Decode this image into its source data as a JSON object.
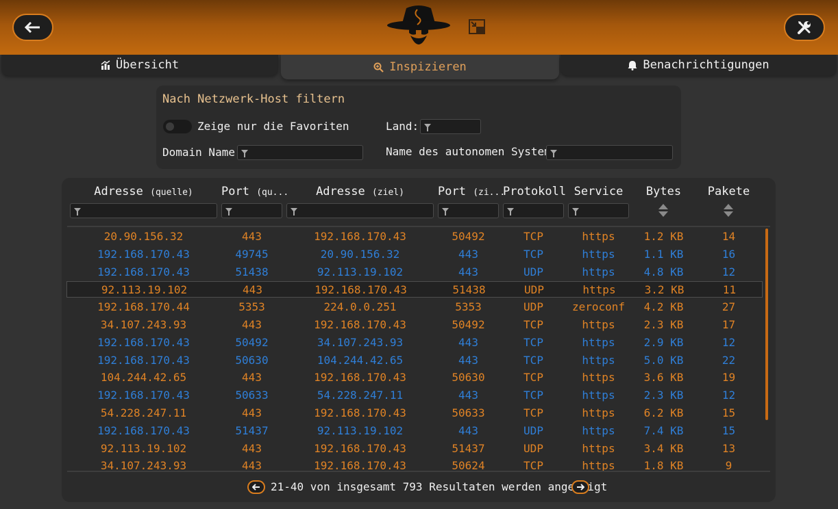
{
  "header": {
    "back_icon": "arrow-left-icon",
    "settings_icon": "wrench-screwdriver-icon",
    "logo_icon": "spy-hat-logo",
    "minimize_icon": "minimize-window-icon",
    "accent": "#d97d1e"
  },
  "tabs": [
    {
      "label": "Übersicht",
      "icon": "chart-icon"
    },
    {
      "label": "Inspizieren",
      "icon": "magnify-icon"
    },
    {
      "label": "Benachrichtigungen",
      "icon": "bell-icon"
    }
  ],
  "filter": {
    "title": "Nach Netzwerk-Host filtern",
    "favorites_label": "Zeige nur die Favoriten",
    "country_label": "Land:",
    "domain_label": "Domain Name:",
    "as_label": "Name des autonomen Systems:",
    "country_value": "",
    "domain_value": "",
    "as_value": ""
  },
  "table": {
    "headers": {
      "src_addr": "Adresse",
      "src_addr_sub": "(quelle)",
      "src_port": "Port",
      "src_port_sub": "(qu...",
      "dst_addr": "Adresse",
      "dst_addr_sub": "(ziel)",
      "dst_port": "Port",
      "dst_port_sub": "(zi...",
      "proto": "Protokoll",
      "service": "Service",
      "bytes": "Bytes",
      "packets": "Pakete"
    },
    "rows": [
      {
        "dir": "in",
        "src": "20.90.156.32",
        "sport": "443",
        "dst": "192.168.170.43",
        "dport": "50492",
        "proto": "TCP",
        "service": "https",
        "bytes": "1.2 KB",
        "packets": "14"
      },
      {
        "dir": "out",
        "src": "192.168.170.43",
        "sport": "49745",
        "dst": "20.90.156.32",
        "dport": "443",
        "proto": "TCP",
        "service": "https",
        "bytes": "1.1 KB",
        "packets": "16"
      },
      {
        "dir": "out",
        "src": "192.168.170.43",
        "sport": "51438",
        "dst": "92.113.19.102",
        "dport": "443",
        "proto": "UDP",
        "service": "https",
        "bytes": "4.8 KB",
        "packets": "12"
      },
      {
        "dir": "in",
        "src": "92.113.19.102",
        "sport": "443",
        "dst": "192.168.170.43",
        "dport": "51438",
        "proto": "UDP",
        "service": "https",
        "bytes": "3.2 KB",
        "packets": "11",
        "selected": true
      },
      {
        "dir": "in",
        "src": "192.168.170.44",
        "sport": "5353",
        "dst": "224.0.0.251",
        "dport": "5353",
        "proto": "UDP",
        "service": "zeroconf",
        "bytes": "4.2 KB",
        "packets": "27"
      },
      {
        "dir": "in",
        "src": "34.107.243.93",
        "sport": "443",
        "dst": "192.168.170.43",
        "dport": "50492",
        "proto": "TCP",
        "service": "https",
        "bytes": "2.3 KB",
        "packets": "17"
      },
      {
        "dir": "out",
        "src": "192.168.170.43",
        "sport": "50492",
        "dst": "34.107.243.93",
        "dport": "443",
        "proto": "TCP",
        "service": "https",
        "bytes": "2.9 KB",
        "packets": "12"
      },
      {
        "dir": "out",
        "src": "192.168.170.43",
        "sport": "50630",
        "dst": "104.244.42.65",
        "dport": "443",
        "proto": "TCP",
        "service": "https",
        "bytes": "5.0 KB",
        "packets": "22"
      },
      {
        "dir": "in",
        "src": "104.244.42.65",
        "sport": "443",
        "dst": "192.168.170.43",
        "dport": "50630",
        "proto": "TCP",
        "service": "https",
        "bytes": "3.6 KB",
        "packets": "19"
      },
      {
        "dir": "out",
        "src": "192.168.170.43",
        "sport": "50633",
        "dst": "54.228.247.11",
        "dport": "443",
        "proto": "TCP",
        "service": "https",
        "bytes": "2.3 KB",
        "packets": "12"
      },
      {
        "dir": "in",
        "src": "54.228.247.11",
        "sport": "443",
        "dst": "192.168.170.43",
        "dport": "50633",
        "proto": "TCP",
        "service": "https",
        "bytes": "6.2 KB",
        "packets": "15"
      },
      {
        "dir": "out",
        "src": "192.168.170.43",
        "sport": "51437",
        "dst": "92.113.19.102",
        "dport": "443",
        "proto": "UDP",
        "service": "https",
        "bytes": "7.4 KB",
        "packets": "15"
      },
      {
        "dir": "in",
        "src": "92.113.19.102",
        "sport": "443",
        "dst": "192.168.170.43",
        "dport": "51437",
        "proto": "UDP",
        "service": "https",
        "bytes": "3.4 KB",
        "packets": "13"
      },
      {
        "dir": "in",
        "src": "34.107.243.93",
        "sport": "443",
        "dst": "192.168.170.43",
        "dport": "50624",
        "proto": "TCP",
        "service": "https",
        "bytes": "1.8 KB",
        "packets": "9"
      }
    ]
  },
  "pager": {
    "text": "21-40 von insgesamt 793 Resultaten werden angezeigt",
    "prev_icon": "arrow-left-circle-icon",
    "next_icon": "arrow-right-circle-icon"
  },
  "colors": {
    "incoming": "#e08325",
    "outgoing": "#2f7fd8"
  }
}
